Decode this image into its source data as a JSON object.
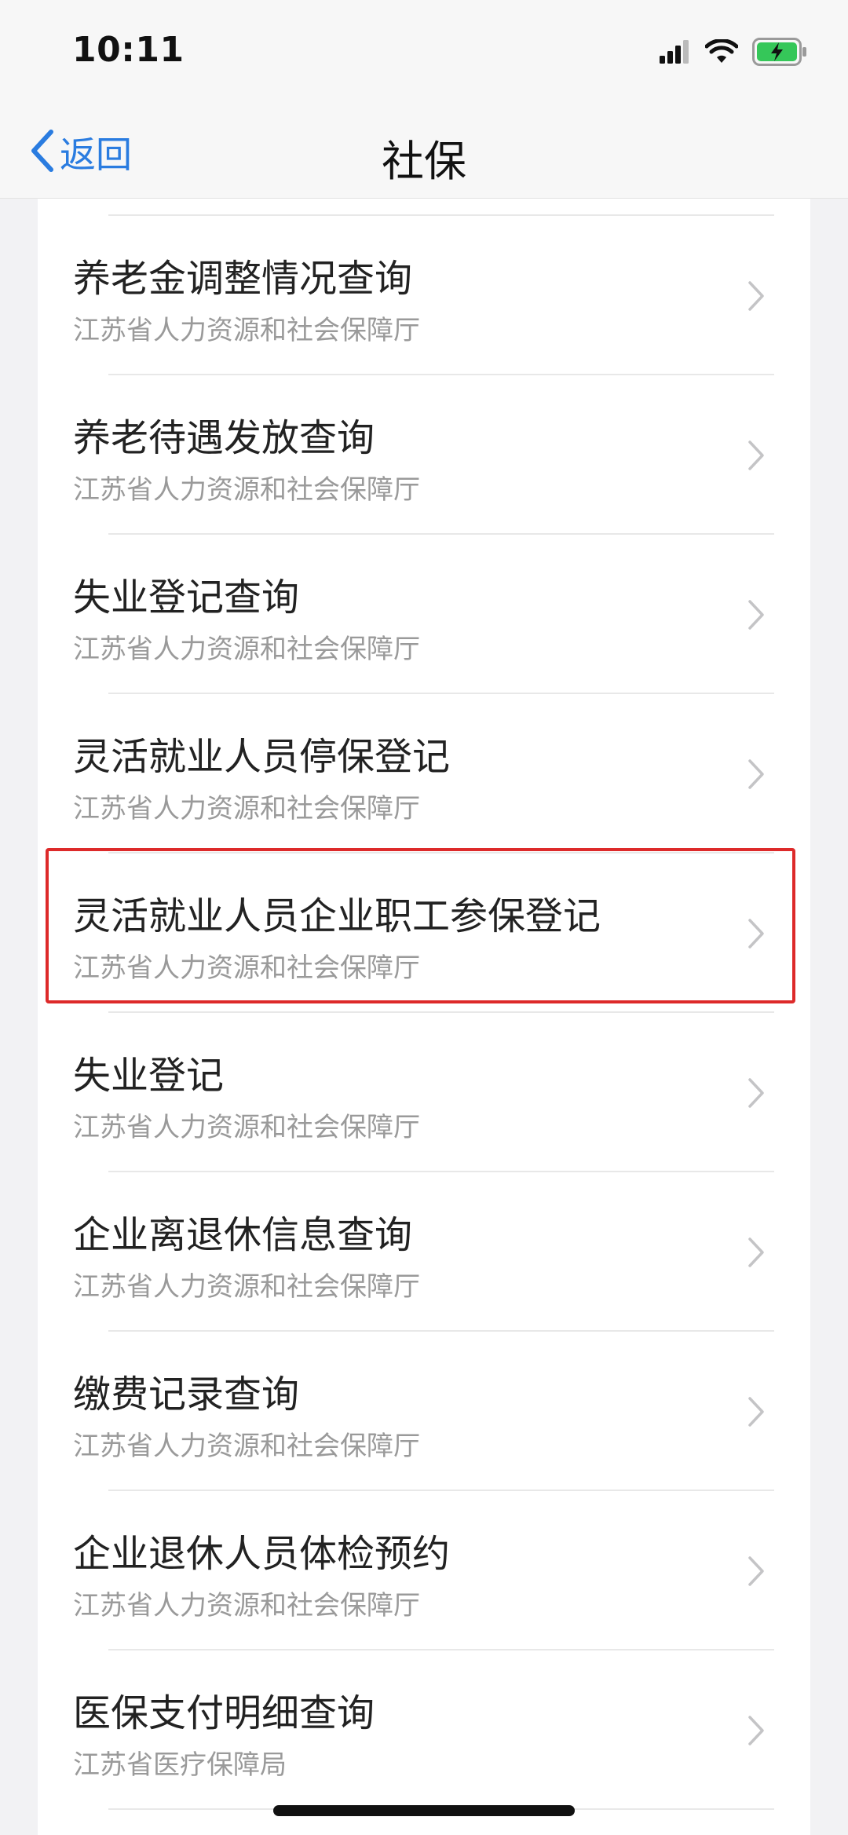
{
  "status_bar": {
    "time": "10:11",
    "icons": [
      "signal-icon",
      "wifi-icon",
      "battery-charging-icon"
    ],
    "battery_color": "#35c759"
  },
  "nav": {
    "back_label": "返回",
    "title": "社保",
    "accent_color": "#2a7ce0"
  },
  "items": [
    {
      "title": "养老金调整情况查询",
      "subtitle": "江苏省人力资源和社会保障厅"
    },
    {
      "title": "养老待遇发放查询",
      "subtitle": "江苏省人力资源和社会保障厅"
    },
    {
      "title": "失业登记查询",
      "subtitle": "江苏省人力资源和社会保障厅"
    },
    {
      "title": "灵活就业人员停保登记",
      "subtitle": "江苏省人力资源和社会保障厅"
    },
    {
      "title": "灵活就业人员企业职工参保登记",
      "subtitle": "江苏省人力资源和社会保障厅",
      "highlighted": true
    },
    {
      "title": "失业登记",
      "subtitle": "江苏省人力资源和社会保障厅"
    },
    {
      "title": "企业离退休信息查询",
      "subtitle": "江苏省人力资源和社会保障厅"
    },
    {
      "title": "缴费记录查询",
      "subtitle": "江苏省人力资源和社会保障厅"
    },
    {
      "title": "企业退休人员体检预约",
      "subtitle": "江苏省人力资源和社会保障厅"
    },
    {
      "title": "医保支付明细查询",
      "subtitle": "江苏省医疗保障局"
    }
  ],
  "highlight_color": "#dd2a2a"
}
